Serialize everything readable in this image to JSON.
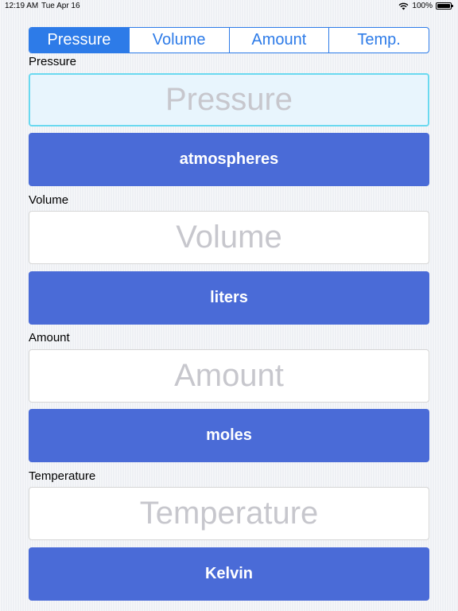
{
  "status_bar": {
    "time": "12:19 AM",
    "date": "Tue Apr 16",
    "battery": "100%"
  },
  "segments": [
    {
      "label": "Pressure",
      "selected": true
    },
    {
      "label": "Volume",
      "selected": false
    },
    {
      "label": "Amount",
      "selected": false
    },
    {
      "label": "Temp.",
      "selected": false
    }
  ],
  "pressure": {
    "label": "Pressure",
    "placeholder": "Pressure",
    "value": "",
    "unit": "atmospheres"
  },
  "volume": {
    "label": "Volume",
    "placeholder": "Volume",
    "value": "",
    "unit": "liters"
  },
  "amount": {
    "label": "Amount",
    "placeholder": "Amount",
    "value": "",
    "unit": "moles"
  },
  "temperature": {
    "label": "Temperature",
    "placeholder": "Temperature",
    "value": "",
    "unit": "Kelvin"
  },
  "colors": {
    "accent": "#2d7be8",
    "unit_button": "#4a6bd7",
    "active_field_bg": "#e8f5fd",
    "active_field_border": "#6ad9f0"
  }
}
